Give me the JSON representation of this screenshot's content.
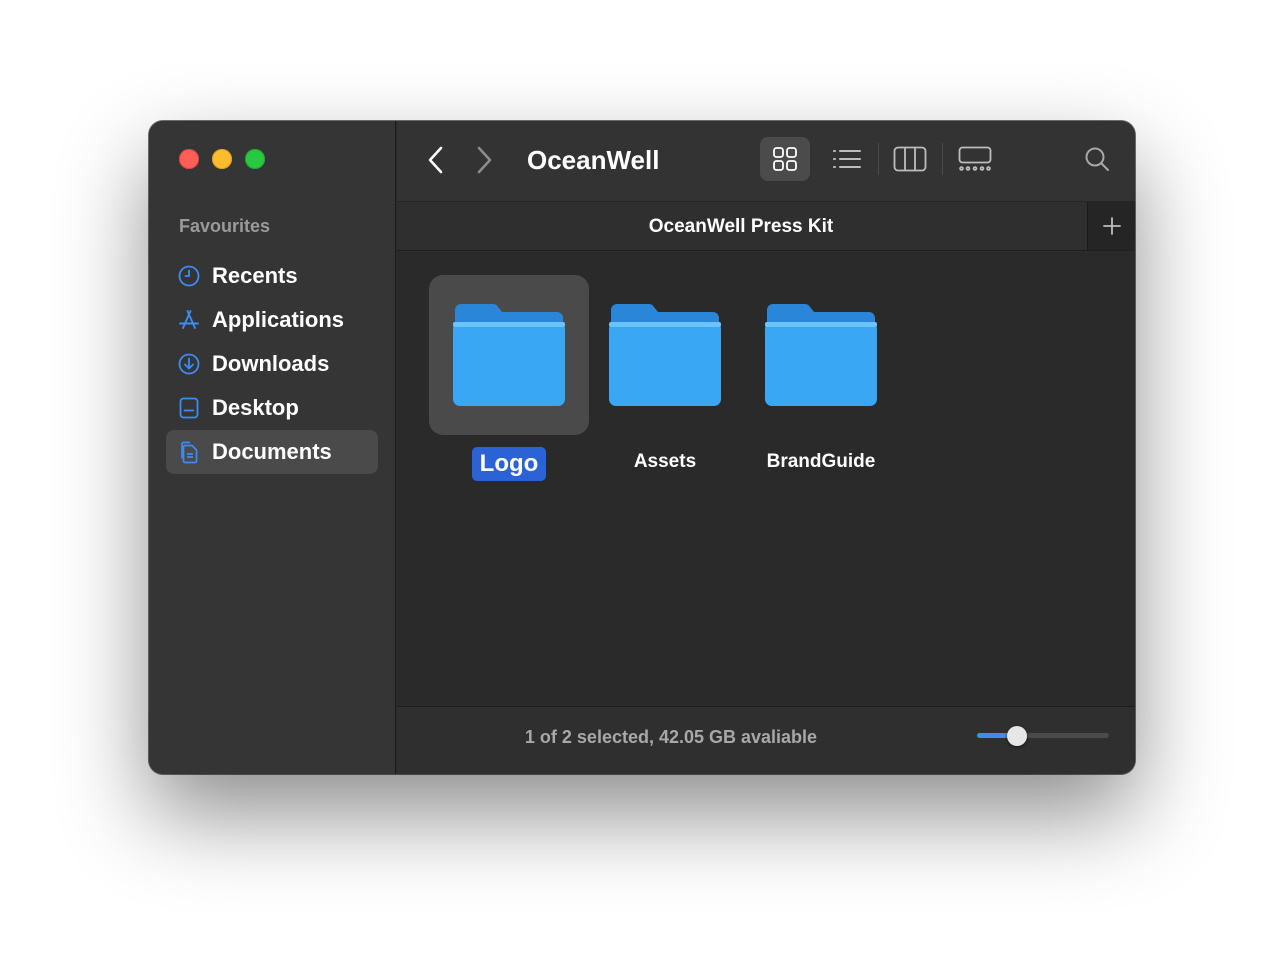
{
  "window": {
    "title": "OceanWell"
  },
  "sidebar": {
    "heading": "Favourites",
    "items": [
      {
        "label": "Recents",
        "icon": "clock-icon",
        "active": false
      },
      {
        "label": "Applications",
        "icon": "app-store-icon",
        "active": false
      },
      {
        "label": "Downloads",
        "icon": "download-icon",
        "active": false
      },
      {
        "label": "Desktop",
        "icon": "desktop-icon",
        "active": false
      },
      {
        "label": "Documents",
        "icon": "documents-icon",
        "active": true
      }
    ]
  },
  "toolbar": {
    "back_icon": "chevron-left-icon",
    "forward_icon": "chevron-right-icon",
    "views": [
      "icon-view-icon",
      "list-view-icon",
      "column-view-icon",
      "gallery-view-icon"
    ],
    "active_view": "icon-view-icon",
    "search_icon": "search-icon"
  },
  "tab": {
    "title": "OceanWell Press Kit",
    "add_icon": "plus-icon"
  },
  "files": [
    {
      "name": "Logo",
      "selected": true
    },
    {
      "name": "Assets",
      "selected": false
    },
    {
      "name": "BrandGuide",
      "selected": false
    }
  ],
  "status": {
    "text": "1 of 2 selected, 42.05 GB avaliable",
    "zoom_fraction": 0.27
  },
  "colors": {
    "accent": "#3b8cf5",
    "selection": "#2b63d6",
    "folder": "#3aa7f5"
  }
}
